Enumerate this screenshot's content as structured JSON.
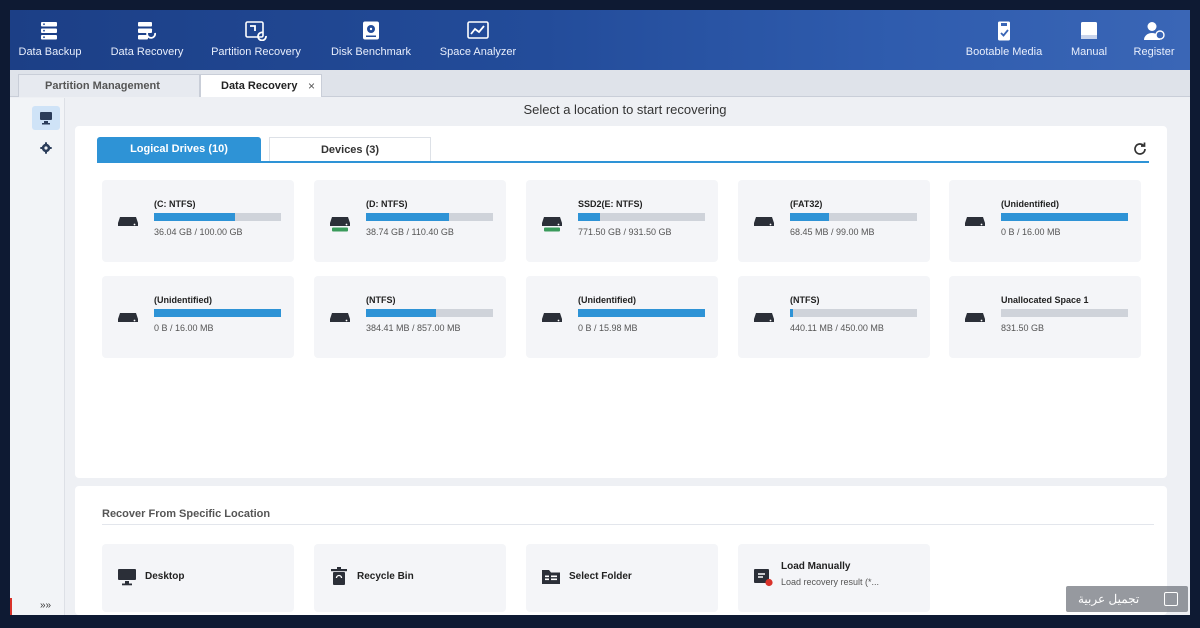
{
  "toolbar": {
    "left": [
      {
        "label": "Data Backup",
        "icon": "data-backup-icon"
      },
      {
        "label": "Data Recovery",
        "icon": "data-recovery-icon"
      },
      {
        "label": "Partition Recovery",
        "icon": "partition-recovery-icon"
      },
      {
        "label": "Disk Benchmark",
        "icon": "disk-benchmark-icon"
      },
      {
        "label": "Space Analyzer",
        "icon": "space-analyzer-icon"
      }
    ],
    "right": [
      {
        "label": "Bootable Media",
        "icon": "bootable-media-icon"
      },
      {
        "label": "Manual",
        "icon": "manual-icon"
      },
      {
        "label": "Register",
        "icon": "register-icon"
      }
    ]
  },
  "tabs": [
    {
      "label": "Partition Management",
      "active": false
    },
    {
      "label": "Data Recovery",
      "active": true,
      "close": "×"
    }
  ],
  "heading": "Select a location to start recovering",
  "panel_tabs": [
    {
      "label": "Logical Drives (10)",
      "active": true
    },
    {
      "label": "Devices (3)",
      "active": false
    }
  ],
  "drives": [
    {
      "name": "(C: NTFS)",
      "size": "36.04 GB / 100.00 GB",
      "used": 0.64,
      "icon": "drive-icon"
    },
    {
      "name": "(D: NTFS)",
      "size": "38.74 GB / 110.40 GB",
      "used": 0.65,
      "icon": "ssd-drive-icon"
    },
    {
      "name": "SSD2(E: NTFS)",
      "size": "771.50 GB / 931.50 GB",
      "used": 0.17,
      "icon": "ssd-drive-icon"
    },
    {
      "name": "(FAT32)",
      "size": "68.45 MB / 99.00 MB",
      "used": 0.31,
      "icon": "drive-icon"
    },
    {
      "name": "(Unidentified)",
      "size": "0 B / 16.00 MB",
      "used": 1.0,
      "icon": "drive-icon"
    },
    {
      "name": "(Unidentified)",
      "size": "0 B / 16.00 MB",
      "used": 1.0,
      "icon": "drive-icon"
    },
    {
      "name": "(NTFS)",
      "size": "384.41 MB / 857.00 MB",
      "used": 0.55,
      "icon": "drive-icon"
    },
    {
      "name": "(Unidentified)",
      "size": "0 B / 15.98 MB",
      "used": 1.0,
      "icon": "drive-icon"
    },
    {
      "name": "(NTFS)",
      "size": "440.11 MB / 450.00 MB",
      "used": 0.02,
      "icon": "drive-icon"
    },
    {
      "name": "Unallocated Space 1",
      "size": "831.50 GB",
      "used": 0.0,
      "icon": "drive-icon"
    }
  ],
  "specific": {
    "title": "Recover From Specific Location",
    "items": [
      {
        "label": "Desktop",
        "icon": "desktop-icon"
      },
      {
        "label": "Recycle Bin",
        "icon": "recycle-bin-icon"
      },
      {
        "label": "Select Folder",
        "icon": "folder-icon"
      },
      {
        "label": "Load Manually",
        "sub": "Load recovery result (*...",
        "icon": "load-manually-icon"
      }
    ]
  },
  "sidebar": {
    "expand": "»»"
  },
  "watermark": "تجميل عربية",
  "colors": {
    "accent": "#2e93d6",
    "toolbar": "#234c9a",
    "bar_empty": "#cfd3da"
  }
}
